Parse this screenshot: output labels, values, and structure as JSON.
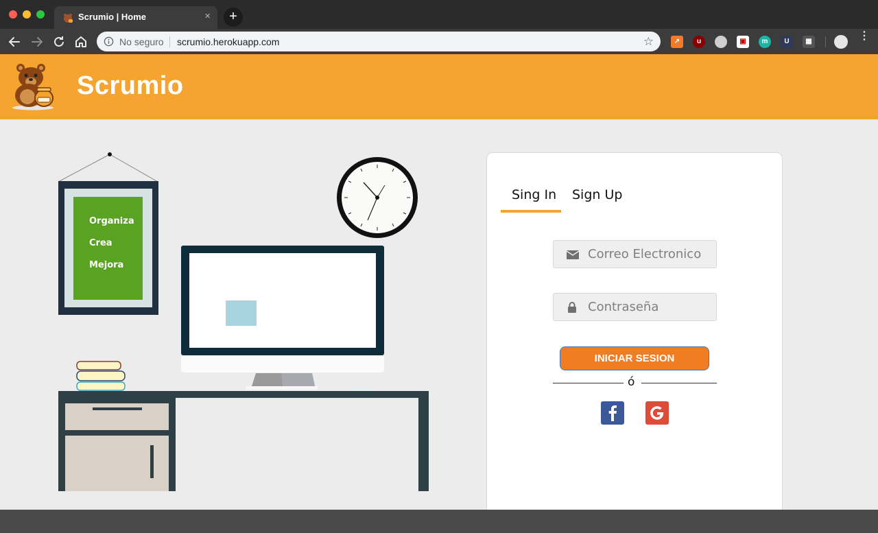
{
  "browser": {
    "tab_title": "Scrumio | Home",
    "tab_close": "×",
    "new_tab": "+",
    "security_label": "No seguro",
    "url": "scrumio.herokuapp.com",
    "bookmark_star": "☆",
    "extensions": [
      "trend-icon",
      "ublock-icon",
      "circle-icon",
      "pdf-icon",
      "m-icon",
      "u-icon",
      "puzzle-icon"
    ],
    "menu": "⋮"
  },
  "header": {
    "brand": "Scrumio",
    "color": "#f5a42f"
  },
  "illustration": {
    "frame_items": [
      "Organiza",
      "Crea",
      "Mejora"
    ],
    "frame_color": "#5aa222"
  },
  "login": {
    "tabs": [
      {
        "label": "Sing In",
        "active": true
      },
      {
        "label": "Sign Up",
        "active": false
      }
    ],
    "email_placeholder": "Correo Electronico",
    "password_placeholder": "Contraseña",
    "submit_label": "INICIAR SESION",
    "separator": "ó",
    "accent": "#f17d22"
  }
}
